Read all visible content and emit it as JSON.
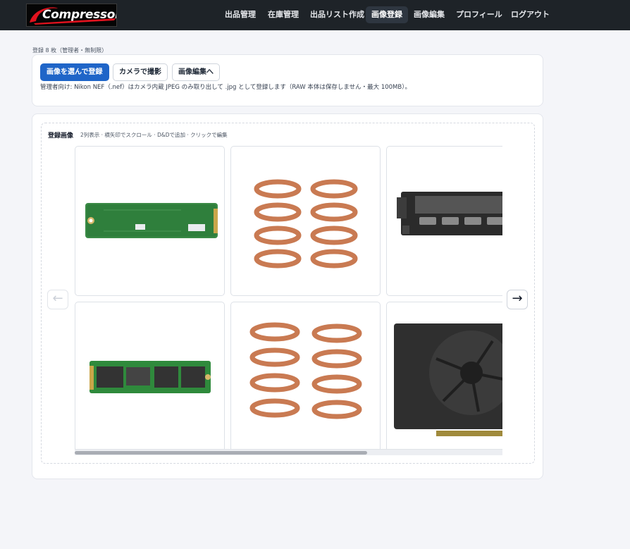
{
  "nav": {
    "logo_text": "Compressor",
    "items": [
      {
        "label": "出品管理",
        "active": false
      },
      {
        "label": "在庫管理",
        "active": false
      },
      {
        "label": "出品リスト作成",
        "active": false
      },
      {
        "label": "画像登録",
        "active": true
      },
      {
        "label": "画像編集",
        "active": false
      },
      {
        "label": "プロフィール",
        "active": false
      },
      {
        "label": "ログアウト",
        "active": false
      }
    ]
  },
  "upload": {
    "summary": "登録 8 枚（管理者・無制限）",
    "select_button": "画像を選んで登録",
    "camera_button": "カメラで撮影",
    "edit_button": "画像編集へ",
    "note": "管理者向け: Nikon NEF（.nef）はカメラ内蔵 JPEG のみ取り出して .jpg として登録します（RAW 本体は保存しません・最大 100MB）。"
  },
  "gallery": {
    "title": "登録画像",
    "hint": "2列表示 · 横矢印でスクロール · D&Dで追加 · クリックで編集",
    "prev_arrow": "←",
    "next_arrow": "→",
    "images": [
      {
        "subject": "m2-ssd-back"
      },
      {
        "subject": "coil-springs"
      },
      {
        "subject": "graphics-card-io"
      },
      {
        "subject": "m2-ssd-front"
      },
      {
        "subject": "coil-springs"
      },
      {
        "subject": "graphics-card-fan"
      }
    ]
  },
  "colors": {
    "navbar": "#1e2328",
    "primary": "#1f65c8",
    "logo_red": "#e1121e",
    "pcb_green": "#2f8a3c",
    "spring_copper": "#c97a52"
  }
}
